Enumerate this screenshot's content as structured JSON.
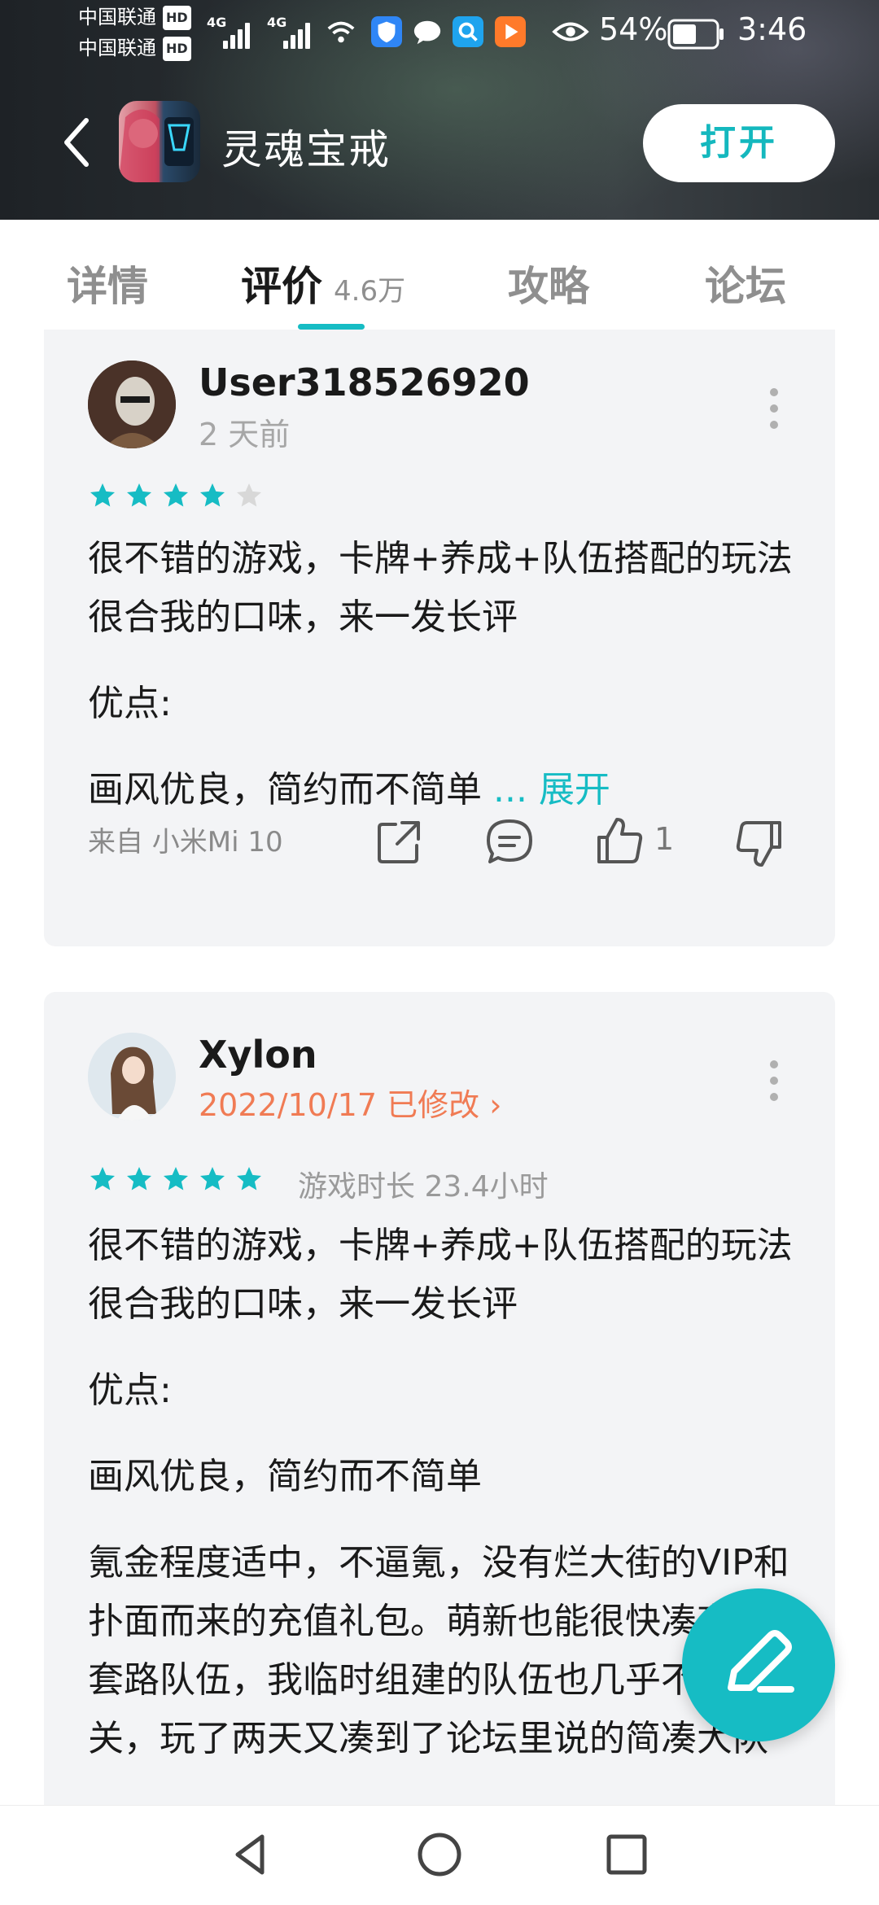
{
  "status_bar": {
    "carrier1": "中国联通",
    "carrier2": "中国联通",
    "hd_badge": "HD",
    "network1": "4G",
    "network2": "4G",
    "battery": "54%",
    "time": "3:46"
  },
  "header": {
    "app_name": "灵魂宝戒",
    "open_label": "打开",
    "accent": "#16bcc4"
  },
  "tabs": [
    {
      "label": "详情",
      "active": false
    },
    {
      "label": "评价",
      "count": "4.6万",
      "active": true
    },
    {
      "label": "攻略",
      "active": false
    },
    {
      "label": "论坛",
      "active": false
    }
  ],
  "reviews": [
    {
      "username": "User318526920",
      "date": "2 天前",
      "rating": 4,
      "paragraphs": [
        "很不错的游戏，卡牌+养成+队伍搭配的玩法很合我的口味，来一发长评",
        "优点:",
        "画风优良，简约而不简单"
      ],
      "expand_prefix": " ... ",
      "expand_label": "展开",
      "device": "来自 小米Mi 10",
      "likes": "1"
    },
    {
      "username": "Xylon",
      "date": "2022/10/17 已修改",
      "date_arrow": "›",
      "rating": 5,
      "playtime": "游戏时长 23.4小时",
      "paragraphs": [
        "很不错的游戏，卡牌+养成+队伍搭配的玩法很合我的口味，来一发长评",
        "优点:",
        "画风优良，简约而不简单",
        "氪金程度适中，不逼氪，没有烂大街的VIP和扑面而来的充值礼包。萌新也能很快凑齐一支套路队伍，我临时组建的队伍也几乎不会卡关，玩了两天又凑到了论坛里说的简凑大队"
      ]
    }
  ],
  "fab": {
    "icon": "edit-pen-icon"
  },
  "navbar": {
    "icons": [
      "back-triangle-icon",
      "home-circle-icon",
      "recents-square-icon"
    ]
  }
}
